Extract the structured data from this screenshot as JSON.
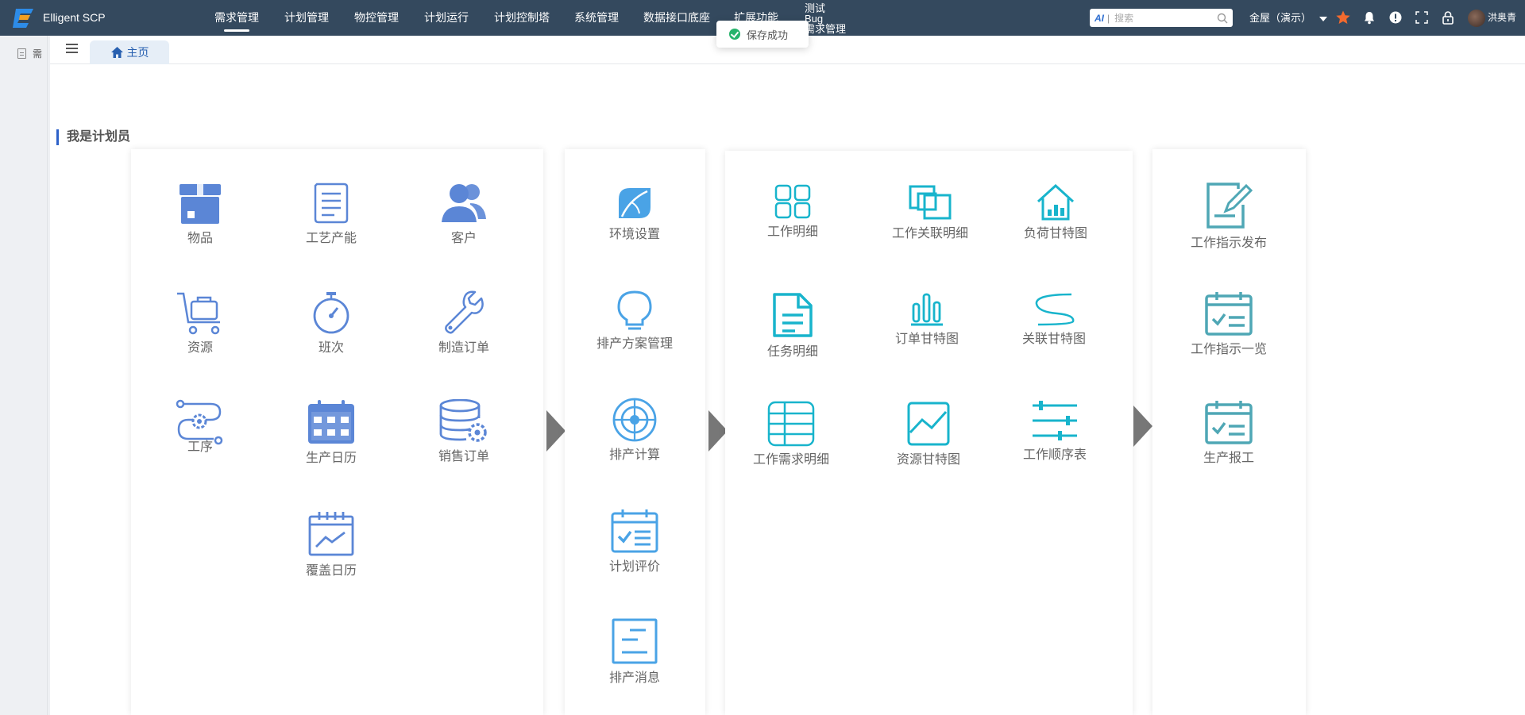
{
  "app": {
    "name": "Elligent SCP"
  },
  "topnav": {
    "items": [
      {
        "label": "需求管理",
        "active": true
      },
      {
        "label": "计划管理"
      },
      {
        "label": "物控管理"
      },
      {
        "label": "计划运行"
      },
      {
        "label": "计划控制塔"
      },
      {
        "label": "系统管理"
      },
      {
        "label": "数据接口底座"
      },
      {
        "label": "扩展功能"
      }
    ],
    "stack_items": [
      "测试",
      "Bug",
      "需求管理"
    ]
  },
  "search": {
    "ai_label": "AI",
    "placeholder": "搜索"
  },
  "company": {
    "label": "金屋（演示）"
  },
  "user": {
    "name": "洪奥青"
  },
  "toast": {
    "message": "保存成功"
  },
  "sidebar": {
    "items": [
      {
        "label": "需"
      }
    ]
  },
  "tabs": [
    {
      "label": "主页",
      "icon": "home-icon"
    }
  ],
  "section": {
    "title": "我是计划员"
  },
  "colors": {
    "topbar": "#34495e",
    "blue_icon": "#5b86d6",
    "sky_icon": "#4aa3e6",
    "cyan_icon": "#18b4cc",
    "teal_icon": "#4fa7b5",
    "accent": "#2e62c9"
  },
  "groups": [
    {
      "name": "master-data",
      "tiles": [
        {
          "label": "物品",
          "icon": "package-icon"
        },
        {
          "label": "工艺产能",
          "icon": "document-icon"
        },
        {
          "label": "客户",
          "icon": "users-icon"
        },
        {
          "label": "资源",
          "icon": "cart-icon"
        },
        {
          "label": "班次",
          "icon": "stopwatch-icon"
        },
        {
          "label": "制造订单",
          "icon": "wrench-icon"
        },
        {
          "label": "工序",
          "icon": "process-route-icon"
        },
        {
          "label": "生产日历",
          "icon": "calendar-icon"
        },
        {
          "label": "销售订单",
          "icon": "database-gear-icon"
        },
        {
          "label": "覆盖日历",
          "icon": "calendar-chart-icon"
        }
      ]
    },
    {
      "name": "scheduling",
      "tiles": [
        {
          "label": "环境设置",
          "icon": "leaf-icon"
        },
        {
          "label": "排产方案管理",
          "icon": "lightbulb-icon"
        },
        {
          "label": "排产计算",
          "icon": "target-icon"
        },
        {
          "label": "计划评价",
          "icon": "calendar-check-icon"
        },
        {
          "label": "排产消息",
          "icon": "message-icon"
        }
      ]
    },
    {
      "name": "results",
      "tiles": [
        {
          "label": "工作明细",
          "icon": "grid-icon"
        },
        {
          "label": "工作关联明细",
          "icon": "linked-windows-icon"
        },
        {
          "label": "负荷甘特图",
          "icon": "house-chart-icon"
        },
        {
          "label": "任务明细",
          "icon": "file-text-icon"
        },
        {
          "label": "订单甘特图",
          "icon": "bar-chart-icon"
        },
        {
          "label": "关联甘特图",
          "icon": "s-curve-icon"
        },
        {
          "label": "工作需求明细",
          "icon": "table-icon"
        },
        {
          "label": "资源甘特图",
          "icon": "line-chart-icon"
        },
        {
          "label": "工作顺序表",
          "icon": "sliders-icon"
        }
      ]
    },
    {
      "name": "execution",
      "tiles": [
        {
          "label": "工作指示发布",
          "icon": "edit-document-icon"
        },
        {
          "label": "工作指示一览",
          "icon": "calendar-check-icon"
        },
        {
          "label": "生产报工",
          "icon": "calendar-check-icon"
        }
      ]
    }
  ]
}
